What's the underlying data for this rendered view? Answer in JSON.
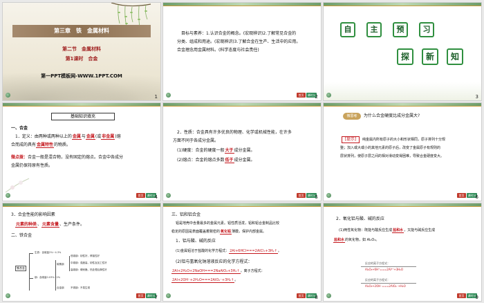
{
  "slides": [
    {
      "num": "1",
      "chapter": "第三章　铁　金属材料",
      "section": "第二节　金属材料",
      "lesson": "第1课时　合金",
      "site": "第一PPT模板网-WWW.1PPT.COM"
    },
    {
      "num": "2",
      "line1": "目标与素养：1.认识合金的概念。(宏观辨识)2.了解常见合金的",
      "line2": "分类、组成和用途。(宏观辨识)3.了解合金在生产、生活中的应用。",
      "line3": "合金理念用金属材料。(科学态度与社会责任)"
    },
    {
      "num": "3",
      "row1": [
        "自",
        "主",
        "预",
        "习"
      ],
      "row2": [
        "探",
        "新",
        "知"
      ]
    },
    {
      "num": "4",
      "tag": "基础知识填充",
      "h1": "一、合金",
      "def_a": "1．定义：由两种或两种以上的",
      "blank1": "金属",
      "def_b": "与",
      "blank2": "金属",
      "def_c": "(或",
      "blank3": "非金属",
      "def_d": ")熔",
      "def2_a": "合而成的具有",
      "blank4": "金属特性",
      "def2_b": "的物质。",
      "warn_label": "微点拨：",
      "warn1": "合金一般是混合物，没有固定的熔点。合金中各成分",
      "warn2": "金属仍保持原有性质。"
    },
    {
      "num": "5",
      "p1a": "2．性质：合金具有许多优良的物理、化学或机械性能，在许多",
      "p1b": "方面不同于各成分金属。",
      "p2a": "(1)硬度：合金的硬度一般",
      "blank1": "大于",
      "p2b": "成分金属。",
      "p3a": "(2)熔点：合金的熔点多数",
      "blank2": "低于",
      "p3b": "成分金属。"
    },
    {
      "num": "6",
      "qlabel": "微思考",
      "q": "为什么合金硬度比成分金属大?",
      "tlabel": "[提示]",
      "a1": "纯金属内所有原子的大小和形状相同，原子排列十分规",
      "a2": "整；加入或大或小的其他元素的原子后，改变了金属原子有规则的",
      "a3": "层状排列，使原子层之间的相对滑动变得困难，导致合金硬度变大。"
    },
    {
      "num": "7",
      "h1": "3．合金性能的影响因素",
      "blank1": "元素的种类",
      "sep": "、",
      "blank2": "元素含量",
      "tail1": "、生产条件。",
      "h2": "二、铁合金",
      "dg_root": "铁合金",
      "dg_a": "生铁：含碳量2%~4.3%",
      "dg_b": "钢：含碳量0.03%~2%",
      "dg_c": "碳素钢",
      "dg_d": "合金钢",
      "dg_e": "低碳钢：韧性好，焊接性好",
      "dg_f": "中碳钢：强度高，韧性及加工性好",
      "dg_g": "高碳钢：硬而脆，热处理后弹性好",
      "dg_h": "不锈钢：不易生锈"
    },
    {
      "num": "8",
      "h1": "三、铝和铝合金",
      "p1": "铝是地壳中含量最多的金属元素。铝性质活泼，铝和铝合金制品比较",
      "p2a": "稳定的原因是表面覆盖着致密的",
      "blank1": "氧化铝",
      "p2b": "薄膜，保护内部金属。",
      "h2": "1．铝与酸、碱的反应",
      "r1a": "(1)金属铝溶于盐酸的化学方程式：",
      "eq1": "2Al+6HCl===2AlCl₃+3H₂↑",
      "r1b": "。",
      "r2a": "(2)铝与氢氧化钠溶液反应的化学方程式：",
      "eq2": "2Al+2H₂O+2NaOH===2NaAlO₂+3H₂↑",
      "r2b": "，离子方程式：",
      "eq3": "2Al+2OH⁻+2H₂O===2AlO₂⁻+3H₂↑",
      "r2c": "。"
    },
    {
      "num": "9",
      "h1": "2．氧化铝与酸、碱的反应",
      "p1a": "(1)两性氧化物：既能与酸反应生成",
      "blank1": "盐和水",
      "p1b": "，又能与碱反应生成",
      "blank2": "盐和水",
      "p2": "的氧化物，如 Al₂O₃。",
      "m1": "反应的离子方程式：",
      "m2": "Al₂O₃+6H⁺===2Al³⁺+3H₂O",
      "m3": "反应的离子方程式：",
      "m4": "Al₂O₃+2OH⁻===2AlO₂⁻+H₂O"
    }
  ],
  "footer": {
    "btn_a": "首页",
    "btn_b": "课时分层"
  },
  "colors": {
    "accent_red": "#c4161c",
    "green": "#2f8f3f",
    "brown": "#8e7152"
  }
}
